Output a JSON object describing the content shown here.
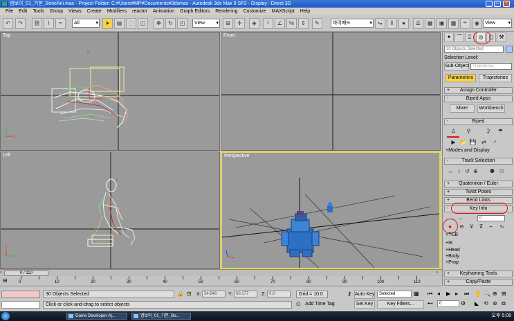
{
  "window": {
    "title": "염보이_01_기본_BoneAni.max    - Project Folder: C:#Users#MP#Documents#3dsmax     - Autodesk 3ds Max 9 SP2     - Display : Direct 3D"
  },
  "menu": [
    "File",
    "Edit",
    "Tools",
    "Group",
    "Views",
    "Create",
    "Modifiers",
    "reactor",
    "Animation",
    "Graph Editors",
    "Rendering",
    "Customize",
    "MAXScript",
    "Help"
  ],
  "toolbar": {
    "selection_filter": "All",
    "reference_coord": "View",
    "named_selection": "바이페드",
    "right_dropdown": "View"
  },
  "viewports": {
    "top": "Top",
    "front": "Front",
    "left": "Left",
    "perspective": "Perspective"
  },
  "panel": {
    "selection_name": "30 Objects Selected",
    "selection_level_label": "Selection Level:",
    "sub_object_label": "Sub-Object",
    "sub_object_value": "Trajectories",
    "tab_parameters": "Parameters",
    "tab_trajectories": "Trajectories",
    "rollouts": {
      "assign_controller": "Assign Controller",
      "biped_apps": "Biped Apps",
      "mixer": "Mixer",
      "workbench": "Workbench",
      "biped": "Biped",
      "modes_display": "Modes and Display",
      "track_selection": "Track Selection",
      "quaternion_euler": "Quaternion / Euler",
      "twist_poses": "Twist Poses",
      "bend_links": "Bend Links",
      "key_info": "Key Info",
      "key_number": "0",
      "tcb": "TCB",
      "ik": "IK",
      "head": "Head",
      "body": "Body",
      "prop": "Prop",
      "keyframing_tools": "Keyframing Tools",
      "copy_paste": "Copy/Paste"
    }
  },
  "timeline": {
    "position": "0 / 110",
    "ticks": [
      "0",
      "10",
      "20",
      "30",
      "40",
      "50",
      "60",
      "70",
      "80",
      "90",
      "100",
      "110"
    ]
  },
  "status": {
    "selection_count": "30 Objects Selected",
    "prompt": "Click or click-and-drag to select objects",
    "x_label": "X:",
    "x_value": "54.646",
    "y_label": "Y:",
    "y_value": "60.177",
    "z_label": "Z:",
    "z_value": "0.0",
    "grid": "Grid = 10.0",
    "add_time_tag": "Add Time Tag",
    "auto_key": "Auto Key",
    "set_key": "Set Key",
    "key_mode_value": "Selected",
    "key_filters": "Key Filters...",
    "frame_value": "0"
  },
  "taskbar": {
    "task1": "Game Developer-A|...",
    "task2": "염보이_01_기본_Bo...",
    "clock": "오후 5:08"
  }
}
